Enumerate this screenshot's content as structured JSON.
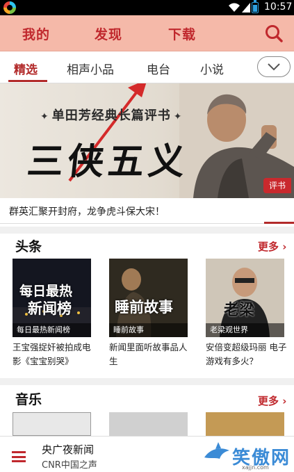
{
  "status_bar": {
    "time": "10:57"
  },
  "header": {
    "tabs": [
      "我的",
      "发现",
      "下载"
    ]
  },
  "categories": {
    "tabs": [
      "精选",
      "相声小品",
      "电台",
      "小说"
    ],
    "active_index": 0
  },
  "banner": {
    "subtitle": "单田芳经典长篇评书",
    "title": "三侠五义",
    "badge": "评书",
    "caption": "群英汇聚开封府，龙争虎斗保大宋！"
  },
  "headlines": {
    "title": "头条",
    "more": "更多",
    "items": [
      {
        "thumb_line1": "每日最热",
        "thumb_line2": "新闻榜",
        "thumb_label": "每日最热新闻榜",
        "title": "王宝强捉奸被拍成电影《宝宝别哭》"
      },
      {
        "thumb_line1": "睡前故事",
        "thumb_label": "睡前故事",
        "title": "新闻里面听故事品人生"
      },
      {
        "thumb_line1": "老梁",
        "thumb_label": "老梁观世界",
        "title": "安倍变超级玛丽 电子游戏有多火？"
      }
    ]
  },
  "music": {
    "title": "音乐",
    "more": "更多"
  },
  "player": {
    "title": "央广夜新闻",
    "subtitle": "CNR中国之声"
  },
  "watermark": {
    "brand": "笑傲网",
    "url": "xajjn.com"
  },
  "colors": {
    "accent": "#c0282d",
    "header_bg": "#f5b9a9"
  }
}
